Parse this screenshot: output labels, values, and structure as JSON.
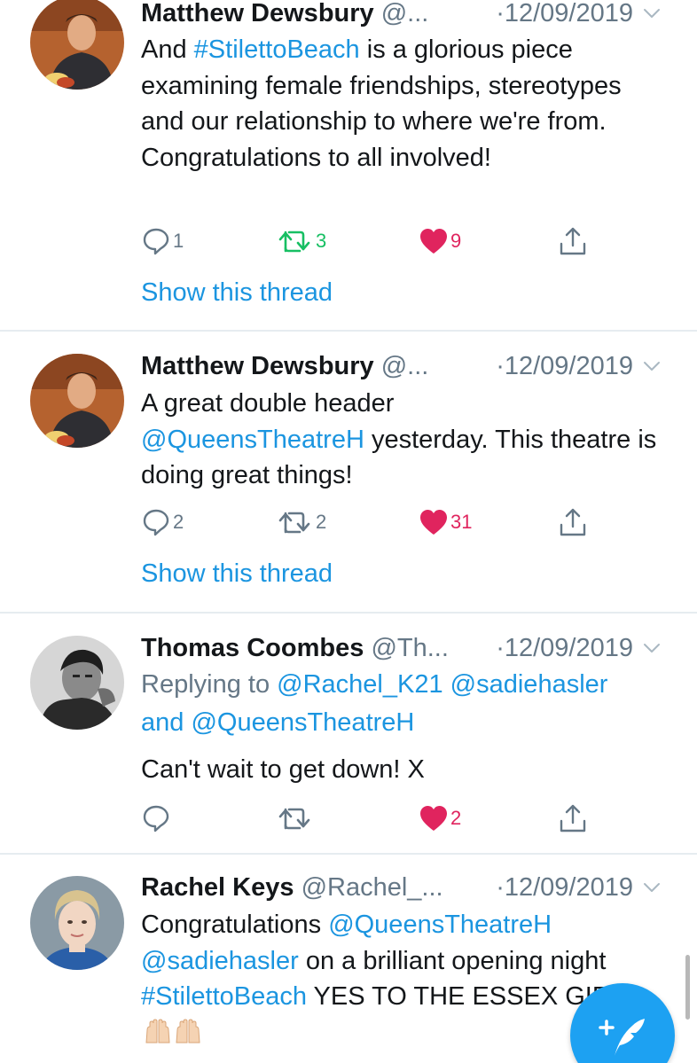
{
  "colors": {
    "link": "#1b95e0",
    "retweet_active": "#17bf63",
    "like": "#e0245e",
    "muted": "#657786",
    "fab": "#1da1f2"
  },
  "tweets": [
    {
      "name": "Matthew Dewsbury",
      "handle": "@...",
      "time": "·12/09/2019",
      "body_parts": [
        "And ",
        "#StilettoBeach",
        " is a glorious piece examining female friendships, stereotypes and our relationship to where we're from. Congratulations to all involved!"
      ],
      "reply_count": "1",
      "retweet_count": "3",
      "like_count": "9",
      "thread_link": "Show this thread"
    },
    {
      "name": "Matthew Dewsbury",
      "handle": "@...",
      "time": "·12/09/2019",
      "body_parts": [
        "A great double header ",
        "@QueensTheatreH",
        " yesterday. This theatre is doing great things!"
      ],
      "reply_count": "2",
      "retweet_count": "2",
      "like_count": "31",
      "thread_link": "Show this thread"
    },
    {
      "name": "Thomas Coombes",
      "handle": "@Th...",
      "time": "·12/09/2019",
      "reply_parts": [
        "Replying to ",
        "@Rachel_K21",
        " ",
        "@sadiehasler",
        " and ",
        "@QueensTheatreH"
      ],
      "body": "Can't wait to get down! X",
      "reply_count": "",
      "retweet_count": "",
      "like_count": "2"
    },
    {
      "name": "Rachel Keys",
      "handle": "@Rachel_...",
      "time": "·12/09/2019",
      "body_parts": [
        "Congratulations ",
        "@QueensTheatreH",
        " ",
        "@sadiehasler",
        " on a brilliant opening night ",
        "#StilettoBeach",
        " YES TO THE ESSEX GIRLS"
      ]
    }
  ],
  "icons": {
    "reply": "reply-icon",
    "retweet": "retweet-icon",
    "like": "heart-icon",
    "share": "share-icon",
    "caret": "chevron-down-icon",
    "compose": "compose-tweet-icon",
    "emoji": "raising-hands-emoji"
  }
}
